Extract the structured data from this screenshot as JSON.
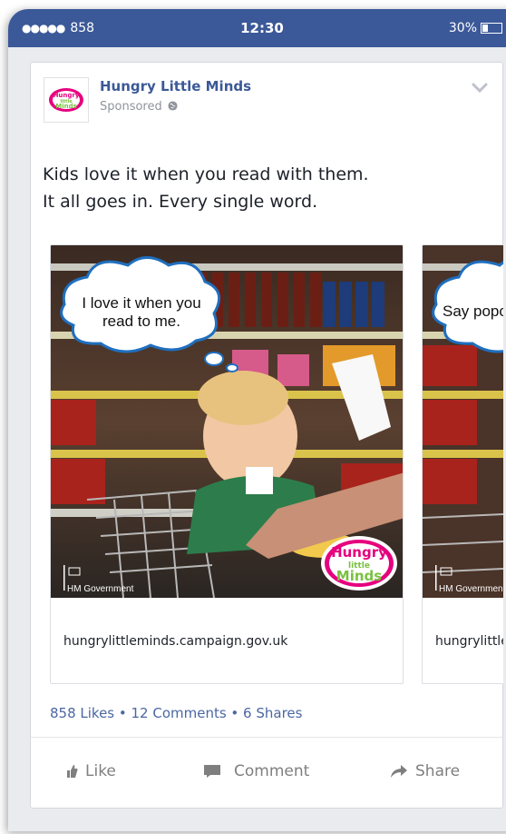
{
  "status_bar": {
    "signal": "●●●●●",
    "carrier": "858",
    "time": "12:30",
    "battery": "30%"
  },
  "post": {
    "page_name": "Hungry Little Minds",
    "sponsored": "Sponsored",
    "text_lines": [
      "Kids love it when you read with them.",
      "It all goes in. Every single word."
    ]
  },
  "carousel": [
    {
      "bubble": [
        "I love it when you",
        "read to me."
      ],
      "gov": "HM Government",
      "caption": "hungrylittleminds.campaign.gov.uk"
    },
    {
      "bubble": [
        "Say popc"
      ],
      "gov": "HM Governmen",
      "caption": "hungrylittle"
    }
  ],
  "logo": {
    "lines": [
      "Hungry",
      "little",
      "Minds"
    ]
  },
  "stats": "858 Likes • 12 Comments • 6 Shares",
  "actions": {
    "like": "Like",
    "comment": "Comment",
    "share": "Share"
  },
  "colors": {
    "brand": "#3b5998",
    "link": "#4b67a1",
    "logo_pink": "#e6007e",
    "logo_green": "#7ac142"
  }
}
